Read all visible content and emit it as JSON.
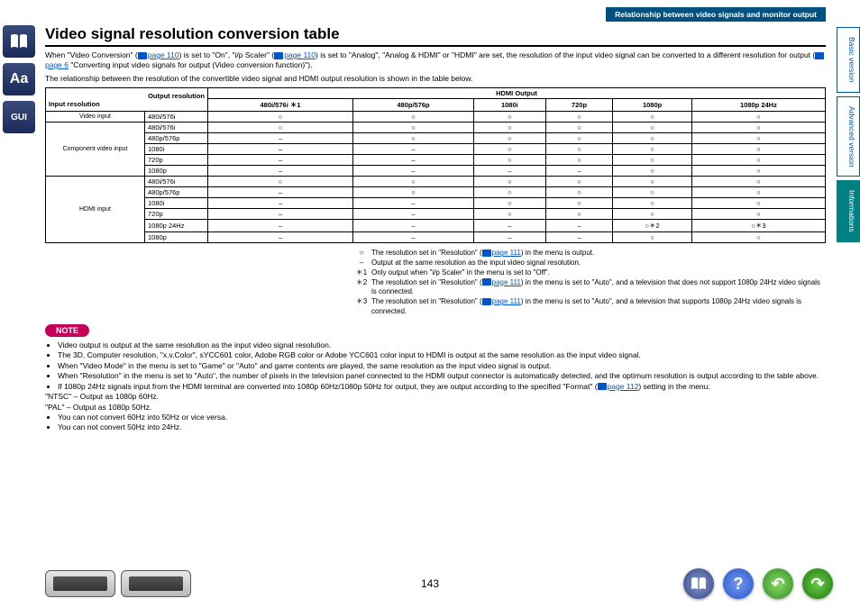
{
  "header": {
    "badge": "Relationship between video signals and monitor output"
  },
  "title": "Video signal resolution conversion table",
  "intro": {
    "p1a": "When \"Video Conversion\" (",
    "p1link1": "page 110",
    "p1b": ") is set to \"On\", \"i/p Scaler\" (",
    "p1link2": "page 110",
    "p1c": ") is set to \"Analog\", \"Analog & HDMI\" or \"HDMI\" are set, the resolution of the input video signal can be converted to a different resolution for output (",
    "p1link3": "page 6",
    "p1d": " \"Converting input video signals for output (Video conversion function)\").",
    "p2": "The relationship between the resolution of the convertible video signal and HDMI output resolution is shown in the table below."
  },
  "table": {
    "hdmi_header": "HDMI Output",
    "out_res_label": "Output resolution",
    "in_res_label": "Input resolution",
    "cols": [
      "480i/576i ＊1",
      "480p/576p",
      "1080i",
      "720p",
      "1080p",
      "1080p 24Hz"
    ],
    "groups": [
      {
        "label": "Video input",
        "rows": [
          {
            "res": "480i/576i",
            "cells": [
              "○",
              "○",
              "○",
              "○",
              "○",
              "○"
            ]
          }
        ]
      },
      {
        "label": "Component video input",
        "rows": [
          {
            "res": "480i/576i",
            "cells": [
              "○",
              "○",
              "○",
              "○",
              "○",
              "○"
            ]
          },
          {
            "res": "480p/576p",
            "cells": [
              "–",
              "○",
              "○",
              "○",
              "○",
              "○"
            ]
          },
          {
            "res": "1080i",
            "cells": [
              "–",
              "–",
              "○",
              "○",
              "○",
              "○"
            ]
          },
          {
            "res": "720p",
            "cells": [
              "–",
              "–",
              "○",
              "○",
              "○",
              "○"
            ]
          },
          {
            "res": "1080p",
            "cells": [
              "–",
              "–",
              "–",
              "–",
              "○",
              "○"
            ]
          }
        ]
      },
      {
        "label": "HDMI input",
        "rows": [
          {
            "res": "480i/576i",
            "cells": [
              "○",
              "○",
              "○",
              "○",
              "○",
              "○"
            ]
          },
          {
            "res": "480p/576p",
            "cells": [
              "–",
              "○",
              "○",
              "○",
              "○",
              "○"
            ]
          },
          {
            "res": "1080i",
            "cells": [
              "–",
              "–",
              "○",
              "○",
              "○",
              "○"
            ]
          },
          {
            "res": "720p",
            "cells": [
              "–",
              "–",
              "○",
              "○",
              "○",
              "○"
            ]
          },
          {
            "res": "1080p 24Hz",
            "cells": [
              "–",
              "–",
              "–",
              "–",
              "○＊2",
              "○＊3"
            ]
          },
          {
            "res": "1080p",
            "cells": [
              "–",
              "–",
              "–",
              "–",
              "○",
              "○"
            ]
          }
        ]
      }
    ]
  },
  "legend": {
    "items": [
      {
        "sym": "○",
        "text_a": "The resolution set in \"Resolution\" (",
        "link": "page 111",
        "text_b": ") in the menu is output."
      },
      {
        "sym": "–",
        "text_a": "Output at the same resolution as the input video signal resolution.",
        "link": "",
        "text_b": ""
      },
      {
        "sym": "＊1",
        "text_a": "Only output when \"i/p Scaler\" in the menu is set to \"Off\".",
        "link": "",
        "text_b": ""
      },
      {
        "sym": "＊2",
        "text_a": "The resolution set in \"Resolution\" (",
        "link": "page 111",
        "text_b": ") in the menu is set to \"Auto\", and a television that does not support 1080p 24Hz video signals is connected."
      },
      {
        "sym": "＊3",
        "text_a": "The resolution set in \"Resolution\" (",
        "link": "page 111",
        "text_b": ") in the menu is set to \"Auto\", and a television that supports 1080p 24Hz video signals is connected."
      }
    ]
  },
  "note_label": "NOTE",
  "notes": {
    "n1": "Video output is output at the same resolution as the input video signal resolution.",
    "n2": "The 3D, Computer resolution, \"x.v.Color\", sYCC601 color, Adobe RGB color or Adobe YCC601 color input to HDMI is output at the same resolution as the input video signal.",
    "n3": "When \"Video Mode\" in the menu is set to \"Game\" or \"Auto\" and game contents are played, the same resolution as the input video signal is output.",
    "n4": "When \"Resolution\" in the menu is set to \"Auto\", the number of pixels in the television panel connected to the HDMI output connector is automatically detected, and the optimum resolution is output according to the table above.",
    "n5a": "If 1080p 24Hz signals input from the HDMI terminal are converted into 1080p 60Hz/1080p 50Hz for output, they are output according to the specified \"Format\" (",
    "n5link": "page 112",
    "n5b": ") setting in the menu:",
    "n5_ntsc": "\"NTSC\" – Output as 1080p 60Hz.",
    "n5_pal": "\"PAL\" – Output as 1080p 50Hz.",
    "n6": "You can not convert 60Hz into 50Hz or vice versa.",
    "n7": "You can not convert 50Hz into 24Hz."
  },
  "tabs": {
    "basic": "Basic version",
    "advanced": "Advanced version",
    "info": "Informations"
  },
  "page_number": "143"
}
